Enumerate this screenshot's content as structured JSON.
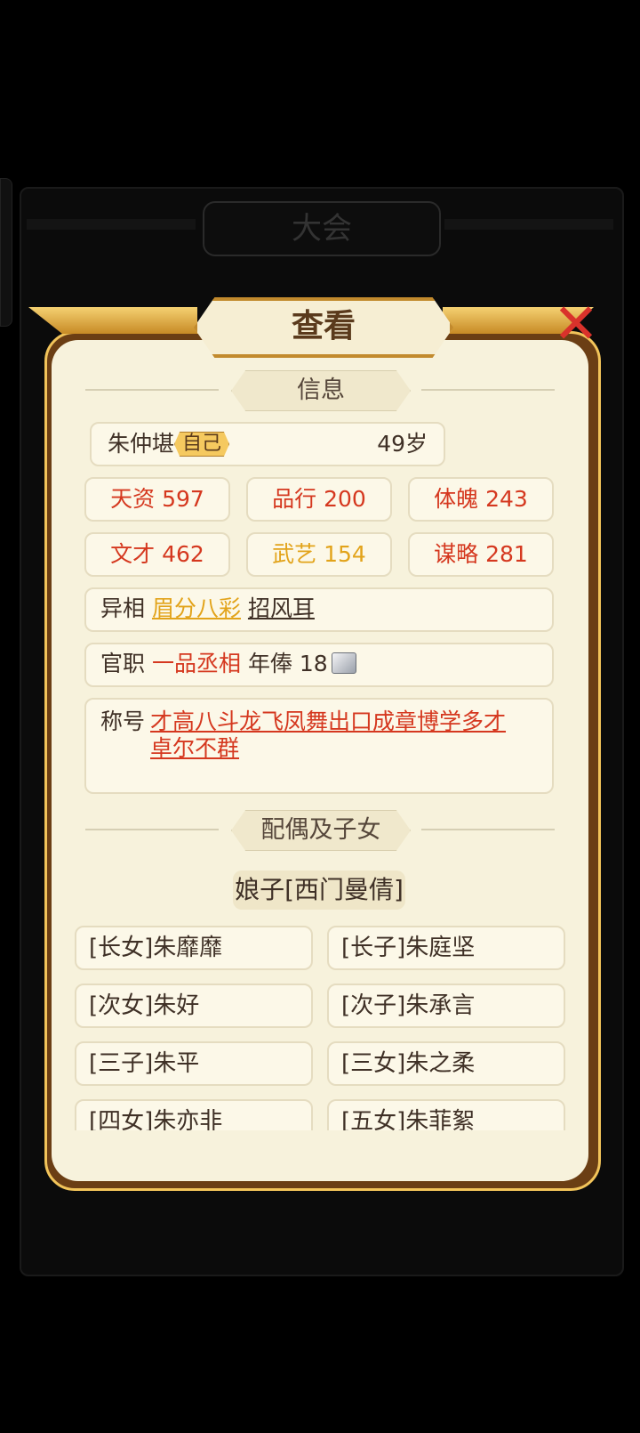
{
  "background": {
    "title": "大会"
  },
  "dialog": {
    "title": "查看",
    "close_icon": "close-x-icon"
  },
  "sections": {
    "info": "信息",
    "family": "配偶及子女"
  },
  "profile": {
    "name": "朱仲堪",
    "tag": "自己",
    "age": "49岁"
  },
  "stats": [
    {
      "label": "天资 597",
      "color": "#d5381f"
    },
    {
      "label": "品行 200",
      "color": "#d5381f"
    },
    {
      "label": "体魄 243",
      "color": "#d5381f"
    },
    {
      "label": "文才 462",
      "color": "#d5381f"
    },
    {
      "label": "武艺 154",
      "color": "#e2a31a"
    },
    {
      "label": "谋略 281",
      "color": "#d5381f"
    }
  ],
  "appearance": {
    "label": "异相",
    "trait1": "眉分八彩",
    "trait2": "招风耳"
  },
  "office": {
    "label": "官职",
    "title": "一品丞相",
    "salary_label": "年俸 18",
    "currency_icon": "silver-ingot-icon"
  },
  "honor": {
    "label": "称号",
    "line1": "才高八斗龙飞凤舞出口成章博学多才",
    "line2": "卓尔不群"
  },
  "spouse": "娘子[西门曼倩]",
  "children": [
    "[长女]朱靡靡",
    "[长子]朱庭坚",
    "[次女]朱好",
    "[次子]朱承言",
    "[三子]朱平",
    "[三女]朱之柔",
    "[四女]朱亦非",
    "[五女]朱菲絮"
  ]
}
